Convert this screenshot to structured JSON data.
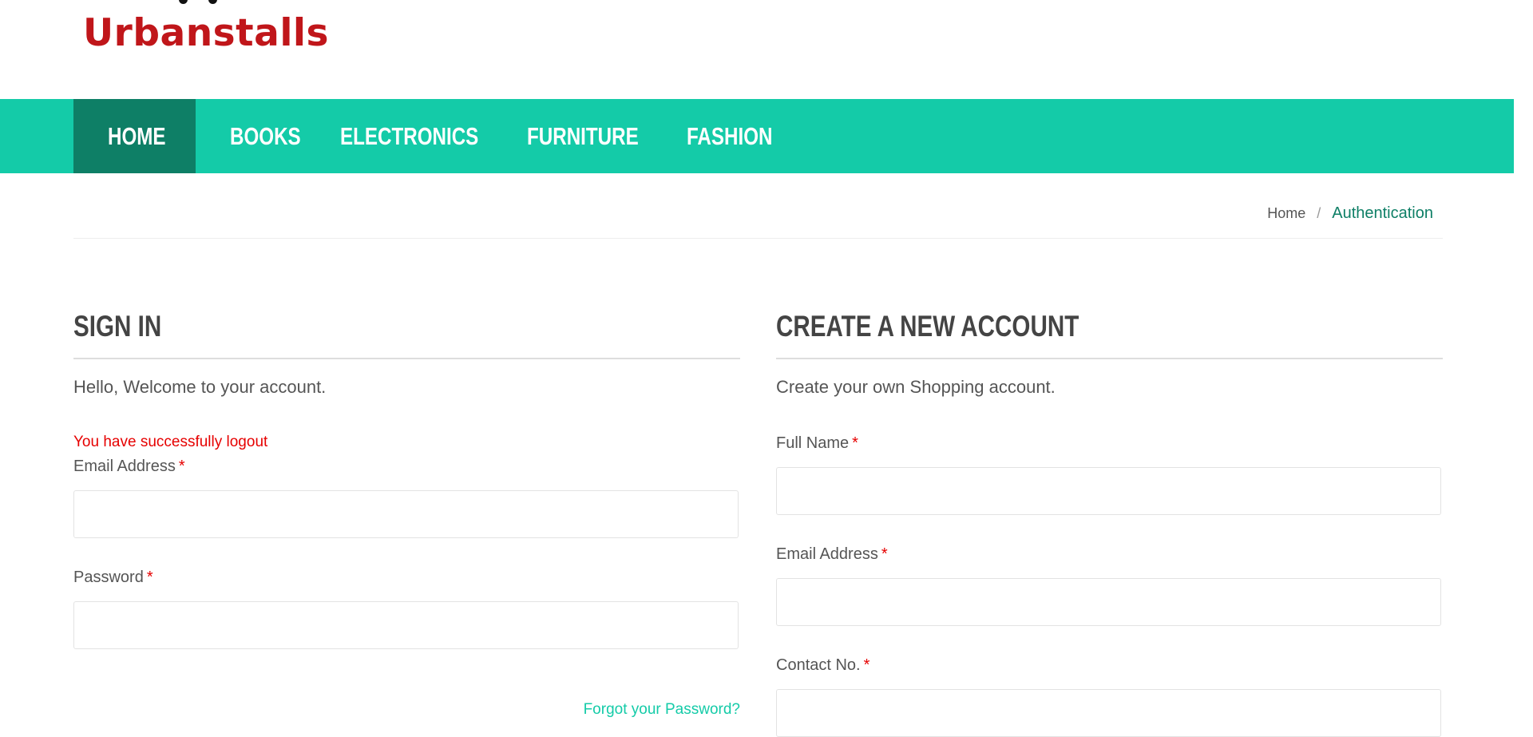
{
  "brand": {
    "name": "Urbanstalls"
  },
  "nav": {
    "items": [
      {
        "label": "HOME",
        "active": true
      },
      {
        "label": "BOOKS",
        "active": false
      },
      {
        "label": "ELECTRONICS",
        "active": false
      },
      {
        "label": "FURNITURE",
        "active": false
      },
      {
        "label": "FASHION",
        "active": false
      }
    ]
  },
  "breadcrumb": {
    "home": "Home",
    "separator": "/",
    "current": "Authentication"
  },
  "signin": {
    "title": "SIGN IN",
    "subtitle": "Hello, Welcome to your account.",
    "alert": "You have successfully logout",
    "email_label": "Email Address",
    "email_value": "",
    "password_label": "Password",
    "password_value": "",
    "required_mark": "*",
    "forgot_link": "Forgot your Password?"
  },
  "signup": {
    "title": "CREATE A NEW ACCOUNT",
    "subtitle": "Create your own Shopping account.",
    "fullname_label": "Full Name",
    "fullname_value": "",
    "email_label": "Email Address",
    "email_value": "",
    "contact_label": "Contact No.",
    "contact_value": "",
    "required_mark": "*"
  },
  "colors": {
    "accent": "#14cba8",
    "accent_dark": "#0e7f66",
    "brand_red": "#c0161a",
    "required_red": "#e60000"
  }
}
